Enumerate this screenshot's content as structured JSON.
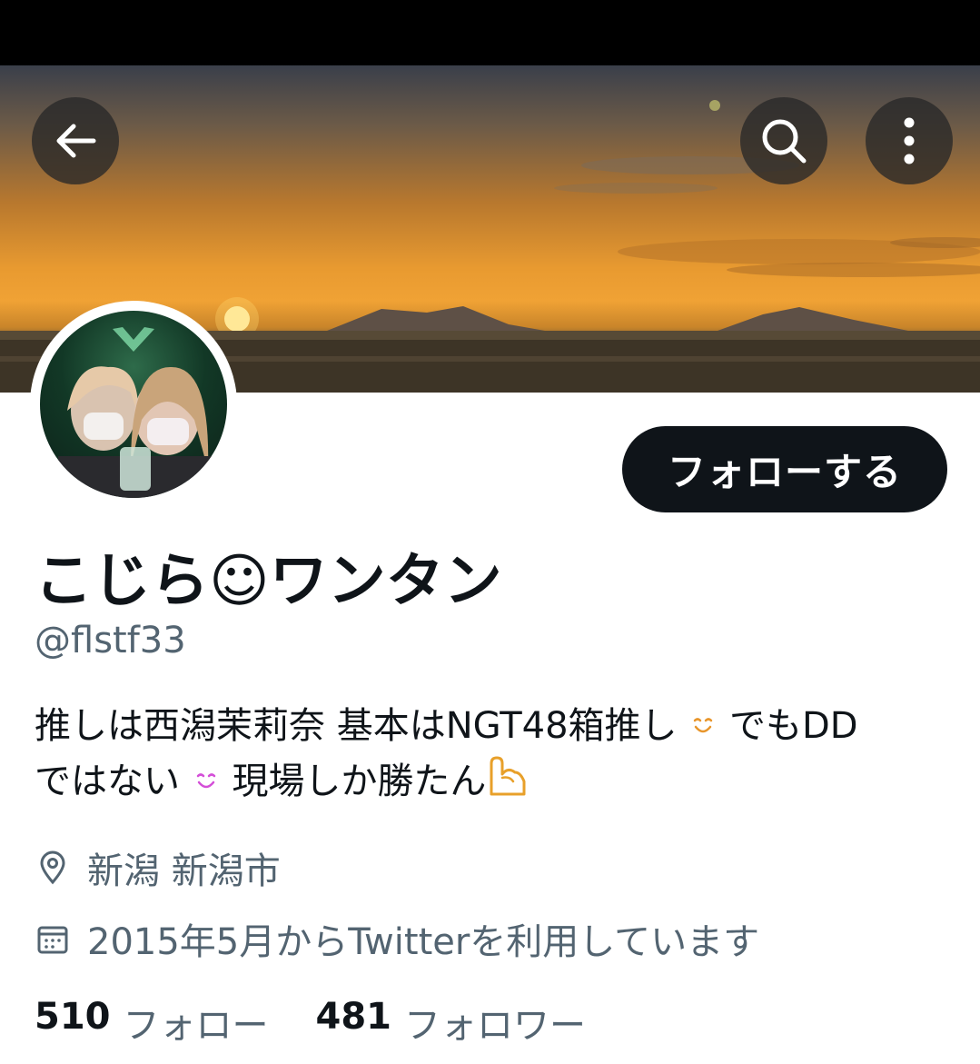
{
  "header": {
    "back_icon": "arrow-left-icon",
    "search_icon": "search-icon",
    "more_icon": "more-vertical-icon"
  },
  "profile": {
    "display_name": "こじら☺ワンタン",
    "handle": "@flstf33",
    "follow_label": "フォローする",
    "bio_lines": [
      {
        "before": "推しは西潟茉莉奈 基本はNGT48箱推し",
        "emoji": "smiling-face-icon",
        "emoji_color": "#e8962c",
        "after": "でもDD"
      },
      {
        "before": "ではない",
        "emoji": "smiling-face-icon",
        "emoji_color": "#d44fd8",
        "after": "現場しか勝たん",
        "emoji2": "flexed-biceps-icon",
        "emoji2_color": "#e8a02a"
      }
    ],
    "location": "新潟 新潟市",
    "joined": "2015年5月からTwitterを利用しています",
    "following_count": "510",
    "following_label": "フォロー",
    "followers_count": "481",
    "followers_label": "フォロワー"
  },
  "colors": {
    "text_primary": "#0f1419",
    "text_secondary": "#536471",
    "button_bg": "#0f1419",
    "banner_sky": "#e89a30"
  }
}
